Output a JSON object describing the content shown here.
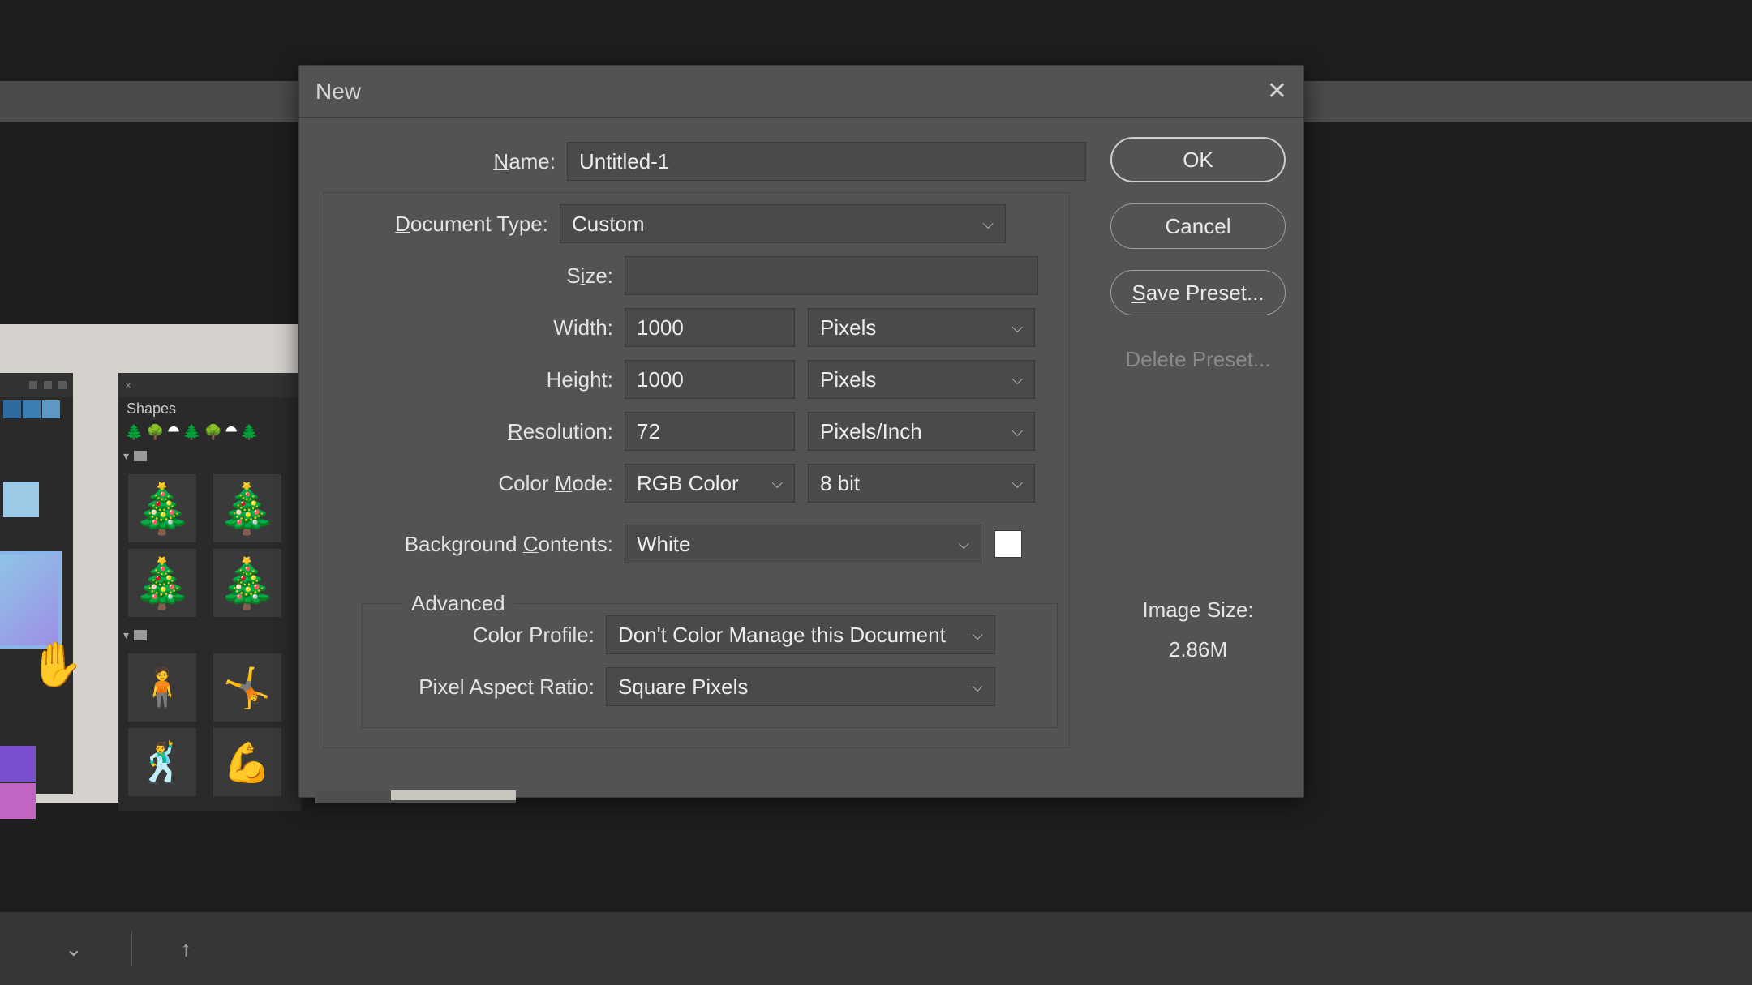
{
  "dialog": {
    "title": "New",
    "name_label": "Name:",
    "name_underline": "N",
    "name_value": "Untitled-1",
    "doc_type_label": "Document Type:",
    "doc_type_underline": "D",
    "doc_type_value": "Custom",
    "size_label": "Size:",
    "size_underline": "i",
    "size_value": "",
    "width_label": "Width:",
    "width_underline": "W",
    "width_value": "1000",
    "width_unit": "Pixels",
    "height_label": "Height:",
    "height_underline": "H",
    "height_value": "1000",
    "height_unit": "Pixels",
    "resolution_label": "Resolution:",
    "resolution_underline": "R",
    "resolution_value": "72",
    "resolution_unit": "Pixels/Inch",
    "color_mode_label": "Color Mode:",
    "color_mode_underline": "M",
    "color_mode_value": "RGB Color",
    "color_bits_value": "8 bit",
    "bg_contents_label": "Background Contents:",
    "bg_contents_underline": "C",
    "bg_contents_value": "White",
    "bg_swatch_color": "#ffffff",
    "advanced_legend": "Advanced",
    "color_profile_label": "Color Profile:",
    "color_profile_value": "Don't Color Manage this Document",
    "pixel_aspect_label": "Pixel Aspect Ratio:",
    "pixel_aspect_value": "Square Pixels",
    "ok_label": "OK",
    "cancel_label": "Cancel",
    "save_preset_label": "Save Preset...",
    "save_preset_underline": "S",
    "delete_preset_label": "Delete Preset...",
    "image_size_label": "Image Size:",
    "image_size_value": "2.86M"
  },
  "shapes_panel": {
    "title": "Shapes"
  }
}
